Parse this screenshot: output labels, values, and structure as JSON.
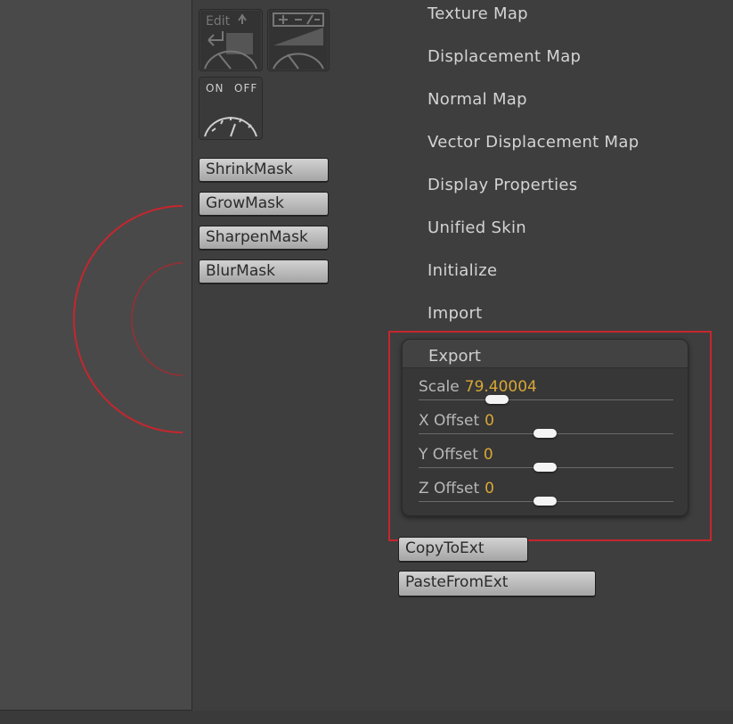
{
  "toolbar": {
    "edit_label": "Edit",
    "plusminus_label": "+ - / -",
    "toggle_on": "ON",
    "toggle_off": "OFF"
  },
  "mask_buttons": [
    "ShrinkMask",
    "GrowMask",
    "SharpenMask",
    "BlurMask"
  ],
  "menu_items": [
    "Texture Map",
    "Displacement Map",
    "Normal Map",
    "Vector Displacement Map",
    "Display Properties",
    "Unified Skin",
    "Initialize",
    "Import"
  ],
  "export": {
    "title": "Export",
    "sliders": [
      {
        "label": "Scale",
        "value": "79.40004"
      },
      {
        "label": "X Offset",
        "value": "0"
      },
      {
        "label": "Y Offset",
        "value": "0"
      },
      {
        "label": "Z Offset",
        "value": "0"
      }
    ]
  },
  "ext_buttons": {
    "copy": "CopyToExt",
    "paste": "PasteFromExt"
  },
  "colors": {
    "highlight": "#c6262e",
    "value_accent": "#d8a737",
    "brush_cursor": "#c6262e"
  }
}
